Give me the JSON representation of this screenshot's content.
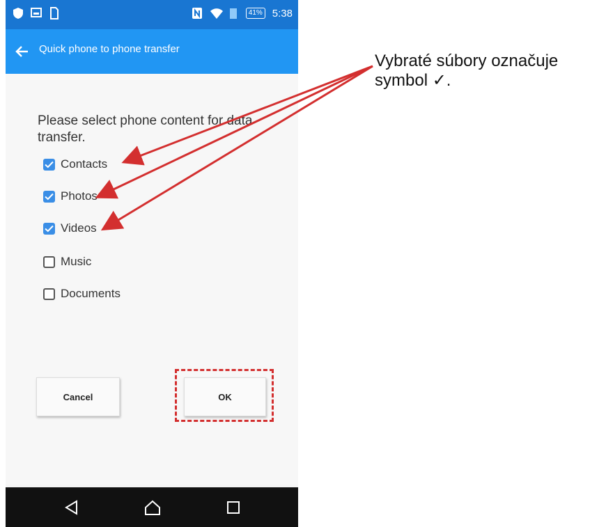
{
  "status_bar": {
    "battery": "41%",
    "time": "5:38",
    "icons": [
      "shield-icon",
      "image-icon",
      "sim-icon",
      "nfc-icon",
      "wifi-icon",
      "signal-icon",
      "battery-icon"
    ]
  },
  "app_bar": {
    "back_icon": "arrow-left-icon",
    "title": "Quick phone to phone transfer"
  },
  "prompt": "Please select phone content for data transfer.",
  "options": [
    {
      "label": "Contacts",
      "checked": true
    },
    {
      "label": "Photos",
      "checked": true
    },
    {
      "label": "Videos",
      "checked": true
    },
    {
      "label": "Music",
      "checked": false
    },
    {
      "label": "Documents",
      "checked": false
    }
  ],
  "buttons": {
    "cancel": "Cancel",
    "ok": "OK"
  },
  "nav_bar": {
    "icons": [
      "back-triangle-icon",
      "home-icon",
      "recents-square-icon"
    ]
  },
  "annotation": {
    "line1": "Vybraté súbory označuje",
    "line2": "symbol ✓."
  },
  "colors": {
    "status_bar": "#1976d2",
    "app_bar": "#2196f3",
    "checkbox_checked": "#3a8ee6",
    "annotation_red": "#d32f2f"
  }
}
